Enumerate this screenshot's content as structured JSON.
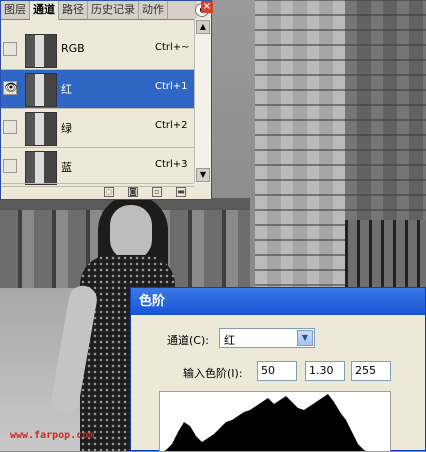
{
  "panel": {
    "tabs": [
      {
        "label": "图层",
        "active": false
      },
      {
        "label": "通道",
        "active": true
      },
      {
        "label": "路径",
        "active": false
      },
      {
        "label": "历史记录",
        "active": false
      },
      {
        "label": "动作",
        "active": false
      }
    ],
    "channels": [
      {
        "name": "RGB",
        "shortcut": "Ctrl+~",
        "visible": false,
        "selected": false
      },
      {
        "name": "红",
        "shortcut": "Ctrl+1",
        "visible": true,
        "selected": true
      },
      {
        "name": "绿",
        "shortcut": "Ctrl+2",
        "visible": false,
        "selected": false
      },
      {
        "name": "蓝",
        "shortcut": "Ctrl+3",
        "visible": false,
        "selected": false
      }
    ]
  },
  "levels": {
    "title": "色阶",
    "channel_label": "通道(C):",
    "channel_value": "红",
    "input_label": "输入色阶(I):",
    "input_black": "50",
    "input_gamma": "1.30",
    "input_white": "255"
  },
  "watermark": "www.farpop.com",
  "colors": {
    "selection": "#3167c4",
    "titlebar": "#1854d6",
    "watermark": "#d2281e"
  }
}
